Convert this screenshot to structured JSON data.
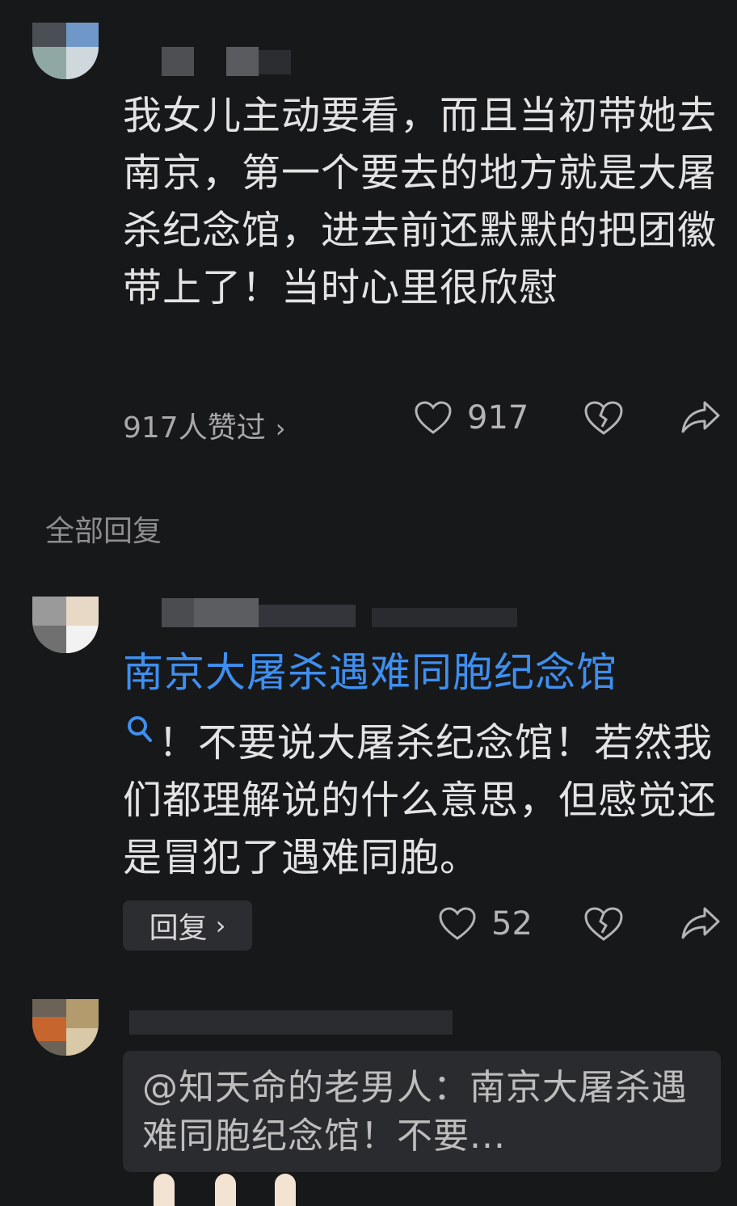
{
  "main_comment": {
    "text": "我女儿主动要看，而且当初带她去南京，第一个要去的地方就是大屠杀纪念馆，进去前还默默的把团徽带上了！当时心里很欣慰",
    "likes_summary": "917人赞过",
    "like_count": "917"
  },
  "section_title": "全部回复",
  "reply1": {
    "link_text": "南京大屠杀遇难同胞纪念馆",
    "text": "！不要说大屠杀纪念馆！若然我们都理解说的什么意思，但感觉还是冒犯了遇难同胞。",
    "reply_label": "回复",
    "like_count": "52"
  },
  "reply2": {
    "quote": "@知天命的老男人：南京大屠杀遇难同胞纪念馆！不要..."
  },
  "icons": {
    "like": "heart-outline-icon",
    "dislike": "broken-heart-icon",
    "share": "share-arrow-icon",
    "search": "search-icon",
    "chevron": "chevron-right-icon"
  },
  "colors": {
    "background": "#17181a",
    "link": "#3e8ff0",
    "text": "#e3e3e3",
    "muted": "#9c9c9c"
  }
}
